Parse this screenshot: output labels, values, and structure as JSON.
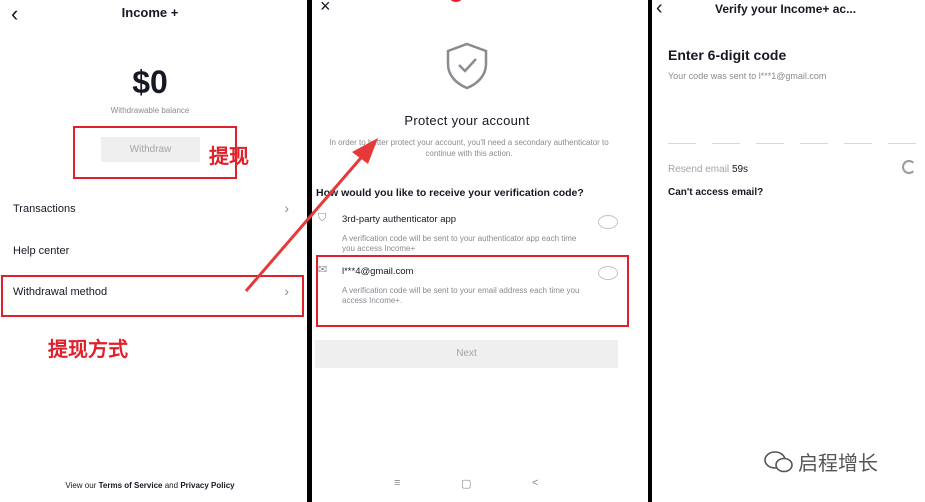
{
  "panel1": {
    "back_icon": "chevron-left-icon",
    "title": "Income +",
    "balance": "$0",
    "balance_label": "Withdrawable balance",
    "withdraw_label": "Withdraw",
    "annotation_withdraw": "提现",
    "menu": [
      {
        "label": "Transactions"
      },
      {
        "label": "Help center"
      },
      {
        "label": "Withdrawal method"
      }
    ],
    "annotation_method": "提现方式",
    "footer": {
      "prefix": "View our",
      "tos": "Terms of Service",
      "and": "and",
      "privacy": "Privacy Policy"
    },
    "accent": "#e0202a"
  },
  "panel2": {
    "close_icon": "close-icon",
    "title": "Protect your account",
    "description": "In order to better protect your account, you'll need a secondary authenticator to continue with this action.",
    "question": "How would you like to receive your verification code?",
    "options": [
      {
        "icon": "shield-icon",
        "label": "3rd-party authenticator app",
        "desc": "A verification code will be sent to your authenticator app each time you access Income+"
      },
      {
        "icon": "mail-icon",
        "label": "l***4@gmail.com",
        "desc": "A verification code will be sent to your email address each time you access Income+."
      }
    ],
    "next_label": "Next",
    "nav": [
      "≡",
      "▢",
      "<"
    ]
  },
  "panel3": {
    "back_icon": "chevron-left-icon",
    "title": "Verify your Income+ ac...",
    "heading": "Enter 6-digit code",
    "subtitle": "Your code was sent to l***1@gmail.com",
    "resend_prefix": "Resend email",
    "resend_timer": "59s",
    "cant_access": "Can't access email?",
    "watermark": "启程增长"
  }
}
